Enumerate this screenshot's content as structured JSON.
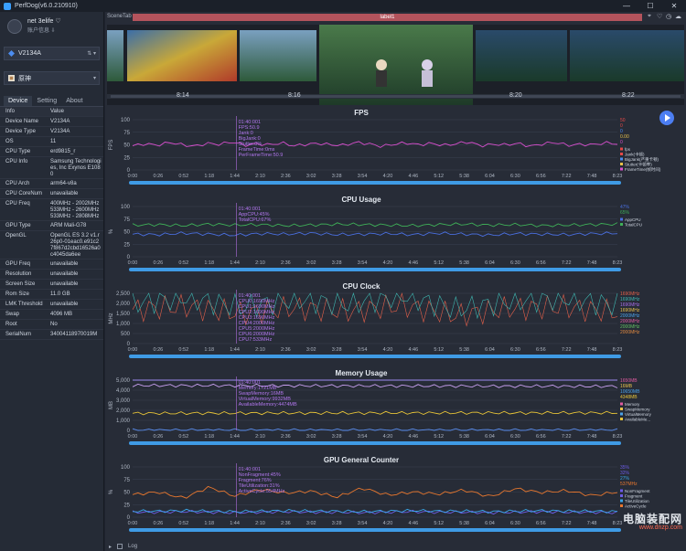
{
  "window": {
    "title": "PerfDog(v6.0.210910)"
  },
  "user": {
    "name": "net 3elife ♡",
    "sub": "账户信息 ⇩"
  },
  "device_selector": {
    "label": "V2134A"
  },
  "app_selector": {
    "label": "原神"
  },
  "tabs": [
    {
      "label": "Device"
    },
    {
      "label": "Setting"
    },
    {
      "label": "About"
    }
  ],
  "info_header": {
    "k": "Info",
    "v": "Value"
  },
  "info_rows": [
    {
      "k": "Device Name",
      "v": "V2134A"
    },
    {
      "k": "Device Type",
      "v": "V2134A"
    },
    {
      "k": "OS",
      "v": "11"
    },
    {
      "k": "CPU Type",
      "v": "erd9815_r"
    },
    {
      "k": "CPU Info",
      "v": "Samsung Technologies, Inc Exynos E1080"
    },
    {
      "k": "CPU Arch",
      "v": "arm64-v8a"
    },
    {
      "k": "CPU CoreNum",
      "v": "unavailable"
    },
    {
      "k": "CPU Freq",
      "v": "400MHz - 2002MHz 533MHz - 2600MHz 533MHz - 2808MHz"
    },
    {
      "k": "GPU Type",
      "v": "ARM Mali-G78"
    },
    {
      "k": "OpenGL",
      "v": "OpenGL ES 3.2 v1.r26p0-01eac0.e91c27f867d2cbd16526a0c4045da6ee"
    },
    {
      "k": "GPU Freq",
      "v": "unavailable"
    },
    {
      "k": "Resolution",
      "v": "unavailable"
    },
    {
      "k": "Screen Size",
      "v": "unavailable"
    },
    {
      "k": "Rom Size",
      "v": "11.0 GB"
    },
    {
      "k": "LMK Threshold",
      "v": "unavailable"
    },
    {
      "k": "Swap",
      "v": "4096 MB"
    },
    {
      "k": "Root",
      "v": "No"
    },
    {
      "k": "SerialNum",
      "v": "34004118970019M"
    }
  ],
  "scene": {
    "label": "SceneTab",
    "bar_label": "label1"
  },
  "thumbnails": [
    {
      "time": "8:14"
    },
    {
      "time": "8:16"
    },
    {
      "time": ""
    },
    {
      "time": "8:20"
    },
    {
      "time": "8:22"
    }
  ],
  "x_ticks": [
    "0:00",
    "0:26",
    "0:52",
    "1:18",
    "1:44",
    "2:10",
    "2:36",
    "3:02",
    "3:28",
    "3:54",
    "4:20",
    "4:46",
    "5:12",
    "5:38",
    "6:04",
    "6:30",
    "6:56",
    "7:22",
    "7:48",
    "8:23"
  ],
  "colors": {
    "fps": "#d94fcf",
    "jank": "#e54848",
    "cpu_app": "#4a6fe0",
    "cpu_total": "#3fb058",
    "mem": "#e6c338",
    "swap": "#5a8ef0",
    "virtual": "#9c8af0",
    "gpu": "#e8772e",
    "gpu2": "#6c5ce7",
    "gpu3": "#3aa6e8"
  },
  "chart_data": [
    {
      "type": "line",
      "title": "FPS",
      "ylabel": "FPS",
      "ylim": [
        0,
        100
      ],
      "yticks": [
        "100",
        "75",
        "50",
        "25",
        "0"
      ],
      "series": [
        {
          "name": "FPS",
          "values": [
            48,
            52,
            49,
            55,
            50,
            47,
            53,
            51,
            56,
            49,
            52,
            50,
            54,
            48,
            51,
            53,
            50,
            49,
            55,
            52,
            47,
            51,
            54,
            50,
            53,
            49,
            52,
            56,
            48,
            51,
            50,
            53,
            47,
            52,
            55,
            49,
            51,
            50,
            54,
            52
          ]
        }
      ],
      "tooltip": [
        "01:40:001",
        "FPS:50.9",
        "Jank:0",
        "BigJank:0",
        "Stutter:0%",
        "FrameTime:0ms",
        "PerFrameTime:50.9"
      ],
      "legend": [
        "fps",
        "Jank(卡顿)",
        "BigJank(严重卡顿)",
        "Stutter(卡顿率)",
        "FrameTime(帧时间)"
      ],
      "legend_values": [
        "50",
        "0",
        "0",
        "0.00",
        "0"
      ]
    },
    {
      "type": "line",
      "title": "CPU Usage",
      "ylabel": "%",
      "ylim": [
        0,
        100
      ],
      "yticks": [
        "100",
        "75",
        "50",
        "25",
        "0"
      ],
      "series": [
        {
          "name": "AppCPU",
          "values": [
            45,
            44,
            47,
            45,
            43,
            46,
            45,
            47,
            44,
            45,
            46,
            44,
            47,
            45,
            43,
            46,
            45,
            44,
            46,
            47
          ]
        },
        {
          "name": "TotalCPU",
          "values": [
            63,
            64,
            62,
            65,
            63,
            64,
            62,
            63,
            65,
            64,
            63,
            62,
            64,
            65,
            63,
            64,
            62,
            63,
            64,
            65
          ]
        }
      ],
      "tooltip": [
        "01:40:001",
        "AppCPU:45%",
        "TotalCPU:67%"
      ],
      "legend": [
        "AppCPU",
        "TotalCPU"
      ],
      "legend_values": [
        "47%",
        "65%"
      ]
    },
    {
      "type": "line",
      "title": "CPU Clock",
      "ylabel": "MHz",
      "ylim": [
        0,
        2500
      ],
      "yticks": [
        "2,500",
        "2,000",
        "1,500",
        "1,000",
        "500",
        "0"
      ],
      "series": [
        {
          "name": "CPU0",
          "values": [
            1690,
            1850,
            1500,
            1780,
            1600,
            1900,
            1400,
            1750,
            1820,
            1550
          ]
        },
        {
          "name": "CPU7",
          "values": [
            2000,
            2300,
            1800,
            2200,
            1950,
            2400,
            1700,
            2100,
            2250,
            1900
          ]
        }
      ],
      "tooltip": [
        "01:40:001",
        "CPU0:1690MHz",
        "CPU1:1690MHz",
        "CPU2:1690MHz",
        "CPU3:1690MHz",
        "CPU4:2000MHz",
        "CPU5:2000MHz",
        "CPU6:2000MHz",
        "CPU7:533MHz"
      ],
      "legend_values": [
        "1690MHz",
        "1690MHz",
        "1690MHz",
        "1690MHz",
        "2000MHz",
        "2000MHz",
        "2000MHz",
        "2000MHz"
      ]
    },
    {
      "type": "line",
      "title": "Memory Usage",
      "ylabel": "MB",
      "ylim": [
        0,
        5000
      ],
      "yticks": [
        "5,000",
        "4,000",
        "3,000",
        "2,000",
        "1,000",
        "0"
      ],
      "series": [
        {
          "name": "Memory",
          "values": [
            1700,
            1710,
            1720,
            1725,
            1730,
            1735,
            1740,
            1740,
            1745,
            1750
          ]
        },
        {
          "name": "SwapMemory",
          "values": [
            16,
            16,
            16,
            16,
            16,
            16,
            16,
            16,
            16,
            16
          ]
        },
        {
          "name": "VirtualMemory",
          "values": [
            9932,
            9932,
            9932,
            9932,
            9932,
            9932,
            9932,
            9932,
            9932,
            9932
          ]
        },
        {
          "name": "AvailableMemory",
          "values": [
            4474,
            4460,
            4450,
            4440,
            4430,
            4420,
            4410,
            4400,
            4390,
            4380
          ]
        }
      ],
      "tooltip": [
        "01:40:001",
        "Memory:1721MB",
        "SwapMemory:16MB",
        "VirtualMemory:9932MB",
        "AvailableMemory:4474MB"
      ],
      "legend": [
        "Memory",
        "SwapMemory",
        "VirtualMemory",
        "AvailableMe..."
      ],
      "legend_values": [
        "1650MB",
        "16MB",
        "10650MB",
        "4348MB"
      ]
    },
    {
      "type": "line",
      "title": "GPU General Counter",
      "ylabel": "%",
      "ylim": [
        0,
        100
      ],
      "yticks": [
        "100",
        "75",
        "50",
        "25",
        "0"
      ],
      "series": [
        {
          "name": "NonFragment",
          "values": [
            45,
            50,
            38,
            60,
            42,
            55,
            48,
            52,
            40,
            58,
            44,
            50,
            46,
            54,
            41,
            57,
            49,
            53,
            43,
            50
          ]
        },
        {
          "name": "Fragment",
          "values": [
            10,
            10,
            11,
            10,
            9,
            10,
            11,
            10,
            10,
            9,
            10,
            11,
            10,
            10,
            9,
            10,
            11,
            10,
            10,
            9
          ]
        },
        {
          "name": "TileUtilization",
          "values": [
            12,
            12,
            13,
            12,
            11,
            12,
            13,
            12,
            12,
            11,
            12,
            13,
            12,
            12,
            11,
            12,
            13,
            12,
            12,
            11
          ]
        }
      ],
      "tooltip": [
        "01:40:001",
        "NonFragment:45%",
        "Fragment:76%",
        "TileUtilization:31%",
        "ActiveCycle:554MHz"
      ],
      "legend": [
        "NonFragment",
        "Fragment",
        "TileUtilization",
        "ActiveCycle"
      ],
      "legend_values": [
        "35%",
        "32%",
        "27%",
        "537MHz"
      ]
    }
  ],
  "bottom": {
    "log_label": "Log"
  },
  "watermark": {
    "line1": "电脑装配网",
    "line2": "www.dnzp.com"
  }
}
